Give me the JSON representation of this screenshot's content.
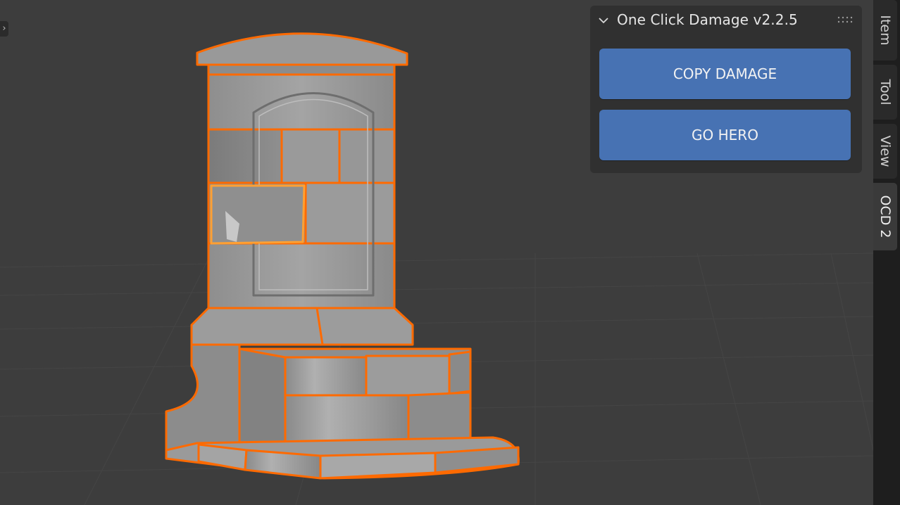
{
  "viewport": {
    "expand_glyph": "›",
    "selection_outline_color": "#ff6a00",
    "active_object_color": "#ffa033"
  },
  "panel": {
    "title": "One Click Damage v2.2.5",
    "collapse_icon": "chevron-down-icon",
    "grip_icon": "drag-grip-icon",
    "buttons": {
      "copy_damage": "COPY DAMAGE",
      "go_hero": "GO HERO"
    },
    "button_color": "#4772b3"
  },
  "tabs": [
    {
      "label": "Item",
      "active": false
    },
    {
      "label": "Tool",
      "active": false
    },
    {
      "label": "View",
      "active": false
    },
    {
      "label": "OCD 2",
      "active": true
    }
  ]
}
